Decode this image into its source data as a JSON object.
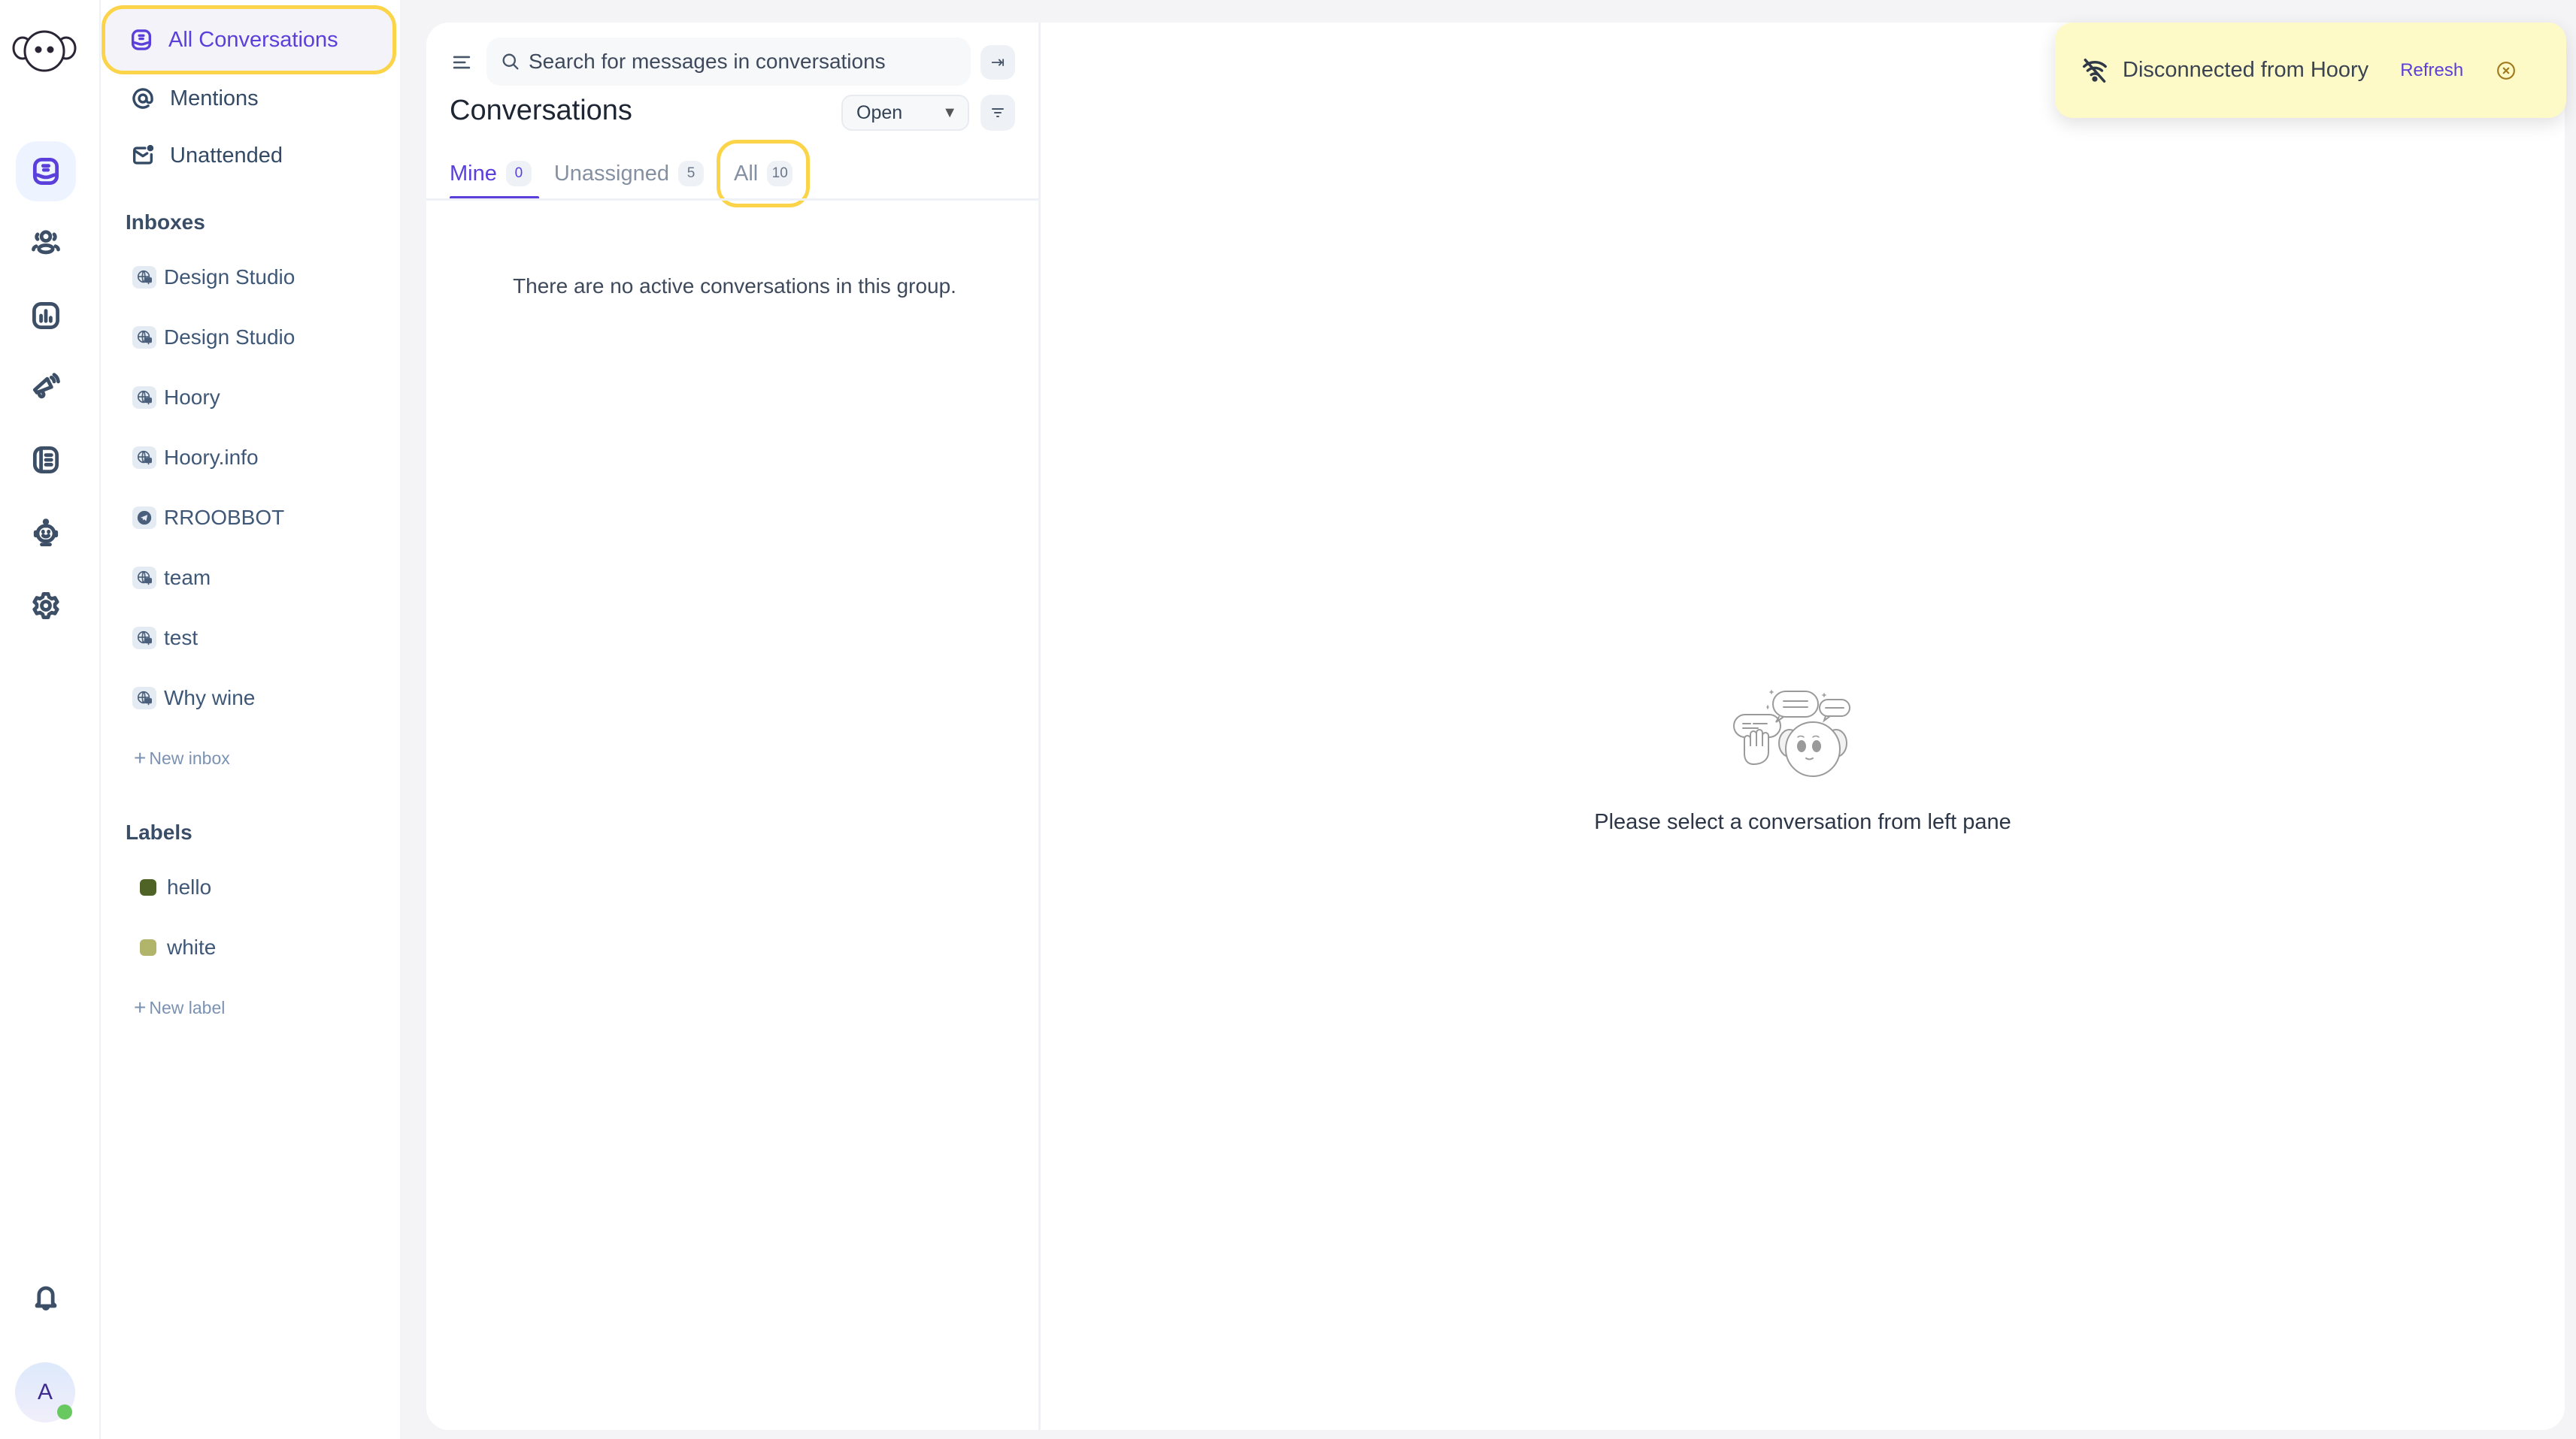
{
  "rail": {
    "logo": "hoory-logo",
    "nav": [
      {
        "id": "conversations",
        "icon": "conversations-icon",
        "active": true
      },
      {
        "id": "contacts",
        "icon": "contacts-icon",
        "active": false
      },
      {
        "id": "reports",
        "icon": "reports-icon",
        "active": false
      },
      {
        "id": "campaigns",
        "icon": "megaphone-icon",
        "active": false
      },
      {
        "id": "help-center",
        "icon": "book-icon",
        "active": false
      },
      {
        "id": "bot",
        "icon": "robot-icon",
        "active": false
      },
      {
        "id": "settings",
        "icon": "gear-icon",
        "active": false
      }
    ],
    "notifications_icon": "bell-icon",
    "avatar_initial": "A",
    "presence_color": "#68c961"
  },
  "sidebar": {
    "primary": [
      {
        "label": "All Conversations",
        "icon": "conversations-icon",
        "active": true
      },
      {
        "label": "Mentions",
        "icon": "at-icon",
        "active": false
      },
      {
        "label": "Unattended",
        "icon": "mail-unread-icon",
        "active": false
      }
    ],
    "inboxes_heading": "Inboxes",
    "inboxes": [
      {
        "label": "Design Studio",
        "icon": "globe-web-icon"
      },
      {
        "label": "Design Studio",
        "icon": "globe-web-icon"
      },
      {
        "label": "Hoory",
        "icon": "globe-web-icon"
      },
      {
        "label": "Hoory.info",
        "icon": "globe-web-icon"
      },
      {
        "label": "RROOBBOT",
        "icon": "telegram-icon"
      },
      {
        "label": "team",
        "icon": "globe-web-icon"
      },
      {
        "label": "test",
        "icon": "globe-web-icon"
      },
      {
        "label": "Why wine",
        "icon": "globe-web-icon"
      }
    ],
    "new_inbox": "New inbox",
    "labels_heading": "Labels",
    "labels": [
      {
        "label": "hello",
        "color": "#4f6326"
      },
      {
        "label": "white",
        "color": "#b0b56b"
      }
    ],
    "new_label": "New label"
  },
  "conversations": {
    "search_placeholder": "Search for messages in conversations",
    "title": "Conversations",
    "status_filter": "Open",
    "tabs": [
      {
        "label": "Mine",
        "count": "0",
        "active": true
      },
      {
        "label": "Unassigned",
        "count": "5",
        "active": false
      },
      {
        "label": "All",
        "count": "10",
        "active": false
      }
    ],
    "empty_message": "There are no active conversations in this group."
  },
  "detail": {
    "empty_message": "Please select a conversation from left pane"
  },
  "toast": {
    "message": "Disconnected from Hoory",
    "action": "Refresh",
    "background": "#fefac8"
  },
  "colors": {
    "accent": "#5b3fdb",
    "focus_ring": "#fbd44a"
  }
}
